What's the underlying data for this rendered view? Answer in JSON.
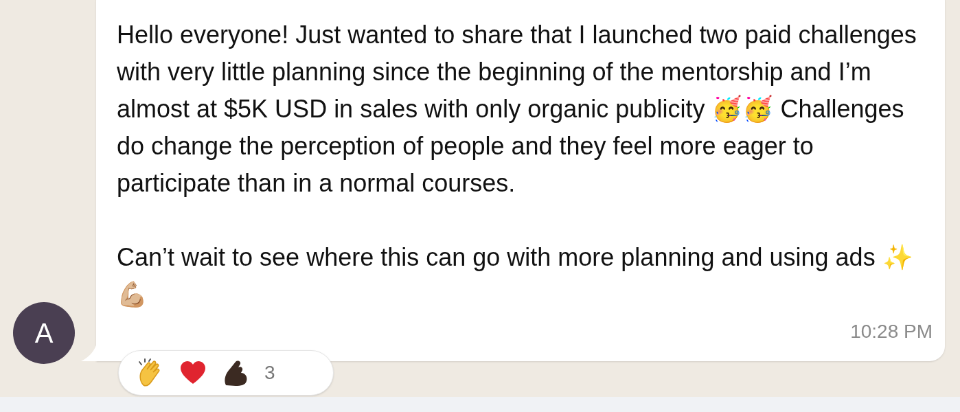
{
  "sender": {
    "initial": "A"
  },
  "message": {
    "paragraphs": [
      "Hello everyone! Just wanted to share that I launched two paid challenges with very little planning since the beginning of the mentorship and I’m almost at $5K USD in sales with only organic publicity 🥳🥳 Challenges do change the perception of people and they feel more eager to participate than in a normal courses.",
      "Can’t wait to see where this can go with more planning and using ads ✨💪🏼"
    ],
    "time": "10:28 PM"
  },
  "reactions": {
    "count": "3"
  }
}
